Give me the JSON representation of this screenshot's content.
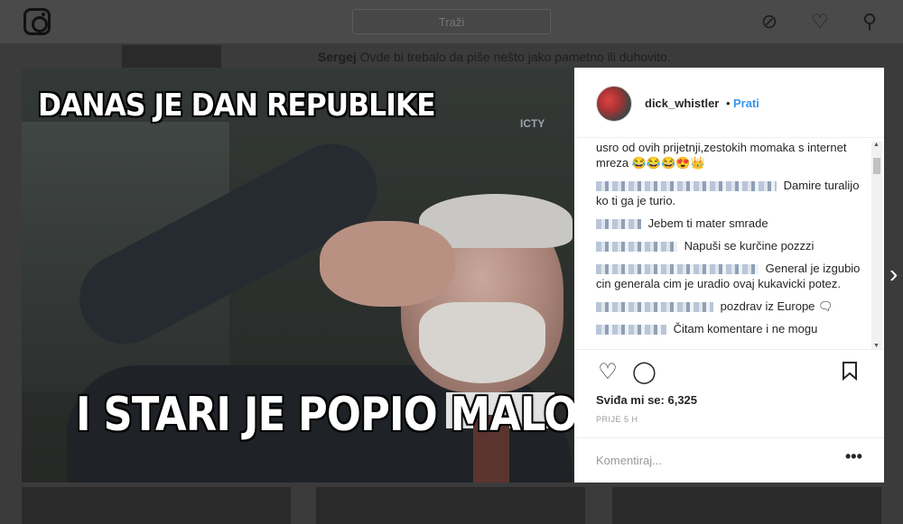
{
  "header": {
    "search_placeholder": "Traži",
    "icons": [
      "instagram-logo",
      "compass-icon",
      "heart-icon",
      "profile-icon"
    ]
  },
  "background_comment": {
    "author": "Sergej",
    "text": "Ovde bi trebalo da piše nešto jako pametno ili duhovito."
  },
  "post": {
    "image_caption_top": "DANAS JE DAN REPUBLIKE",
    "image_caption_bottom": "I STARI JE POPIO MALO",
    "image_watermark": "ICTY",
    "author": "dick_whistler",
    "separator": "•",
    "follow_label": "Prati",
    "comments": [
      {
        "text": "usro od ovih prijetnji,zestokih momaka s internet mreza 😂😂😂😍👑"
      },
      {
        "text": "Damire turalijo ko ti ga je turio."
      },
      {
        "text": "Jebem ti mater smrade"
      },
      {
        "text": "Napuši se kurčine pozzzi"
      },
      {
        "text": "General je izgubio cin generala cim je uradio ovaj kukavicki potez."
      },
      {
        "text": "pozdrav iz Europe 🗨"
      },
      {
        "text": "Čitam komentare i ne mogu"
      }
    ],
    "likes_label": "Sviđa mi se: 6,325",
    "time_ago": "PRIJE 5 H",
    "comment_placeholder": "Komentiraj...",
    "more_label": "•••"
  },
  "navigation": {
    "next_label": "›"
  }
}
